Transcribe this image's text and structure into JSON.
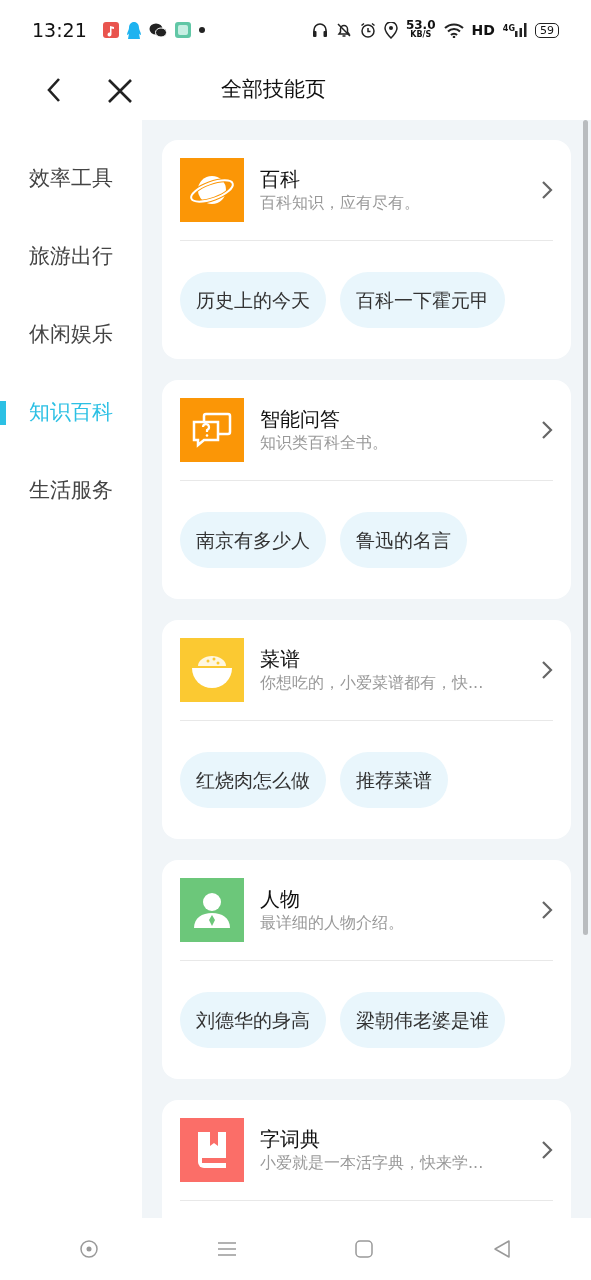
{
  "status_bar": {
    "time": "13:21",
    "net_speed": "53.0",
    "net_unit": "KB/S",
    "hd": "HD",
    "network": "4G",
    "battery": "59"
  },
  "header": {
    "title": "全部技能页"
  },
  "sidebar": {
    "items": [
      {
        "label": "效率工具",
        "selected": false
      },
      {
        "label": "旅游出行",
        "selected": false
      },
      {
        "label": "休闲娱乐",
        "selected": false
      },
      {
        "label": "知识百科",
        "selected": true
      },
      {
        "label": "生活服务",
        "selected": false
      }
    ]
  },
  "skills": [
    {
      "kind": "planet",
      "color": "#fb9606",
      "title": "百科",
      "description": "百科知识，应有尽有。",
      "examples": [
        "历史上的今天",
        "百科一下霍元甲"
      ]
    },
    {
      "kind": "qa",
      "color": "#fb9606",
      "title": "智能问答",
      "description": "知识类百科全书。",
      "examples": [
        "南京有多少人",
        "鲁迅的名言"
      ]
    },
    {
      "kind": "bowl",
      "color": "#fbc932",
      "title": "菜谱",
      "description": "你想吃的，小爱菜谱都有，快...",
      "examples": [
        "红烧肉怎么做",
        "推荐菜谱"
      ]
    },
    {
      "kind": "person",
      "color": "#6cc77a",
      "title": "人物",
      "description": "最详细的人物介绍。",
      "examples": [
        "刘德华的身高",
        "梁朝伟老婆是谁"
      ]
    },
    {
      "kind": "book",
      "color": "#fb6e68",
      "title": "字词典",
      "description": "小爱就是一本活字典，快来学..."
    }
  ]
}
